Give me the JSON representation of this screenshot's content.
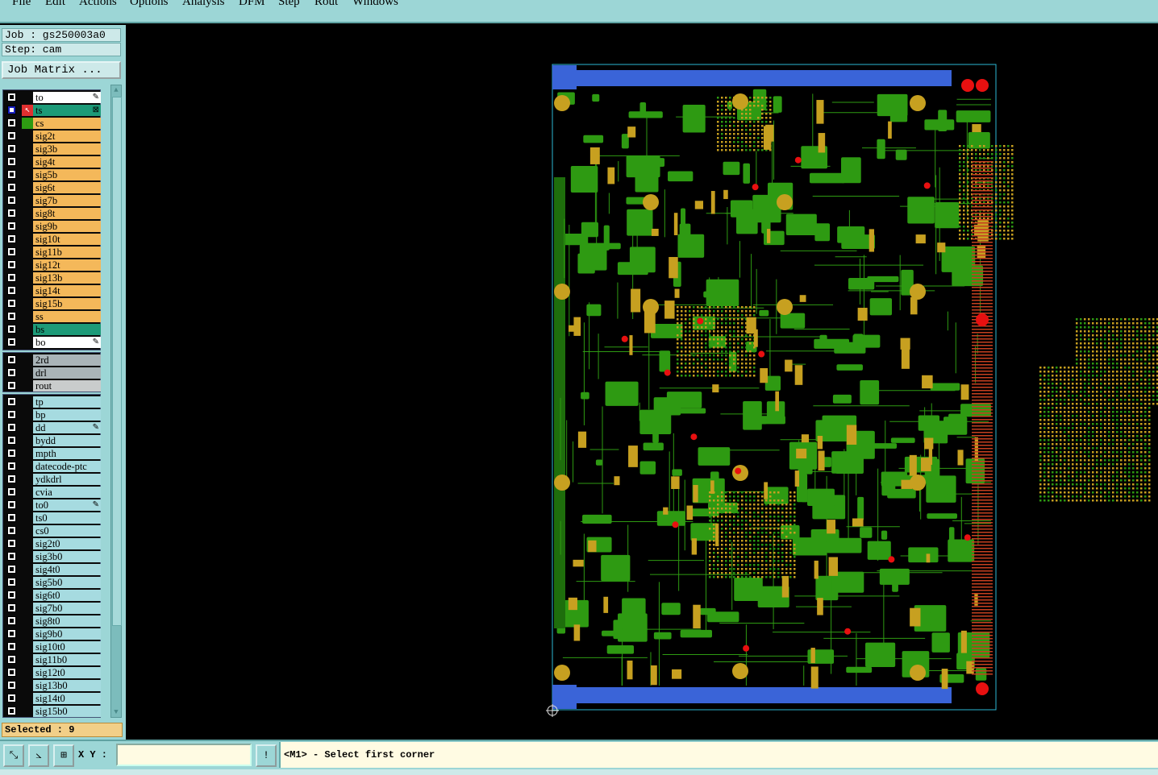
{
  "menu": [
    "File",
    "Edit",
    "Actions",
    "Options",
    "Analysis",
    "DFM",
    "Step",
    "Rout",
    "Windows"
  ],
  "job_line": "Job : gs250003a0",
  "step_line": "Step: cam",
  "job_matrix_button": "Job Matrix ...",
  "layers_board": [
    {
      "name": "to",
      "color": "#ffffff",
      "flag": "✎",
      "mark": ""
    },
    {
      "name": "ts",
      "color": "#1d9a78",
      "flag": "⊠",
      "mark": "cursor",
      "active": true
    },
    {
      "name": "cs",
      "color": "#f4b85a",
      "flag": "",
      "mark": "green"
    },
    {
      "name": "sig2t",
      "color": "#f4b85a",
      "flag": "",
      "mark": ""
    },
    {
      "name": "sig3b",
      "color": "#f4b85a",
      "flag": "",
      "mark": ""
    },
    {
      "name": "sig4t",
      "color": "#f4b85a",
      "flag": "",
      "mark": ""
    },
    {
      "name": "sig5b",
      "color": "#f4b85a",
      "flag": "",
      "mark": ""
    },
    {
      "name": "sig6t",
      "color": "#f4b85a",
      "flag": "",
      "mark": ""
    },
    {
      "name": "sig7b",
      "color": "#f4b85a",
      "flag": "",
      "mark": ""
    },
    {
      "name": "sig8t",
      "color": "#f4b85a",
      "flag": "",
      "mark": ""
    },
    {
      "name": "sig9b",
      "color": "#f4b85a",
      "flag": "",
      "mark": ""
    },
    {
      "name": "sig10t",
      "color": "#f4b85a",
      "flag": "",
      "mark": ""
    },
    {
      "name": "sig11b",
      "color": "#f4b85a",
      "flag": "",
      "mark": ""
    },
    {
      "name": "sig12t",
      "color": "#f4b85a",
      "flag": "",
      "mark": ""
    },
    {
      "name": "sig13b",
      "color": "#f4b85a",
      "flag": "",
      "mark": ""
    },
    {
      "name": "sig14t",
      "color": "#f4b85a",
      "flag": "",
      "mark": ""
    },
    {
      "name": "sig15b",
      "color": "#f4b85a",
      "flag": "",
      "mark": ""
    },
    {
      "name": "ss",
      "color": "#f4b85a",
      "flag": "",
      "mark": ""
    },
    {
      "name": "bs",
      "color": "#1d9a78",
      "flag": "",
      "mark": ""
    },
    {
      "name": "bo",
      "color": "#ffffff",
      "flag": "✎",
      "mark": ""
    }
  ],
  "layers_drill": [
    {
      "name": "2rd",
      "color": "#a9b4b8",
      "flag": "",
      "mark": ""
    },
    {
      "name": "drl",
      "color": "#a9b4b8",
      "flag": "",
      "mark": ""
    },
    {
      "name": "rout",
      "color": "#c9cccc",
      "flag": "",
      "mark": ""
    }
  ],
  "layers_misc": [
    {
      "name": "tp",
      "color": "#a6dbe0",
      "flag": "",
      "mark": ""
    },
    {
      "name": "bp",
      "color": "#a6dbe0",
      "flag": "",
      "mark": ""
    },
    {
      "name": "dd",
      "color": "#a6dbe0",
      "flag": "✎",
      "mark": ""
    },
    {
      "name": "bydd",
      "color": "#a6dbe0",
      "flag": "",
      "mark": ""
    },
    {
      "name": "mpth",
      "color": "#a6dbe0",
      "flag": "",
      "mark": ""
    },
    {
      "name": "datecode-ptc",
      "color": "#a6dbe0",
      "flag": "",
      "mark": ""
    },
    {
      "name": "ydkdrl",
      "color": "#a6dbe0",
      "flag": "",
      "mark": ""
    },
    {
      "name": "cvia",
      "color": "#a6dbe0",
      "flag": "",
      "mark": ""
    },
    {
      "name": "to0",
      "color": "#a6dbe0",
      "flag": "✎",
      "mark": ""
    },
    {
      "name": "ts0",
      "color": "#a6dbe0",
      "flag": "",
      "mark": ""
    },
    {
      "name": "cs0",
      "color": "#a6dbe0",
      "flag": "",
      "mark": ""
    },
    {
      "name": "sig2t0",
      "color": "#a6dbe0",
      "flag": "",
      "mark": ""
    },
    {
      "name": "sig3b0",
      "color": "#a6dbe0",
      "flag": "",
      "mark": ""
    },
    {
      "name": "sig4t0",
      "color": "#a6dbe0",
      "flag": "",
      "mark": ""
    },
    {
      "name": "sig5b0",
      "color": "#a6dbe0",
      "flag": "",
      "mark": ""
    },
    {
      "name": "sig6t0",
      "color": "#a6dbe0",
      "flag": "",
      "mark": ""
    },
    {
      "name": "sig7b0",
      "color": "#a6dbe0",
      "flag": "",
      "mark": ""
    },
    {
      "name": "sig8t0",
      "color": "#a6dbe0",
      "flag": "",
      "mark": ""
    },
    {
      "name": "sig9b0",
      "color": "#a6dbe0",
      "flag": "",
      "mark": ""
    },
    {
      "name": "sig10t0",
      "color": "#a6dbe0",
      "flag": "",
      "mark": ""
    },
    {
      "name": "sig11b0",
      "color": "#a6dbe0",
      "flag": "",
      "mark": ""
    },
    {
      "name": "sig12t0",
      "color": "#a6dbe0",
      "flag": "",
      "mark": ""
    },
    {
      "name": "sig13b0",
      "color": "#a6dbe0",
      "flag": "",
      "mark": ""
    },
    {
      "name": "sig14t0",
      "color": "#a6dbe0",
      "flag": "",
      "mark": ""
    },
    {
      "name": "sig15b0",
      "color": "#a6dbe0",
      "flag": "",
      "mark": ""
    }
  ],
  "selected": "Selected : 9",
  "xy_label": "X Y :",
  "xy_value": "",
  "prompt": "<M1> - Select first corner",
  "colors": {
    "panel": "#9cd6d6",
    "board_copper": "#2e9a12",
    "board_pads": "#c7a020",
    "board_edge": "#3a64d8",
    "fiducial": "#e81010"
  }
}
